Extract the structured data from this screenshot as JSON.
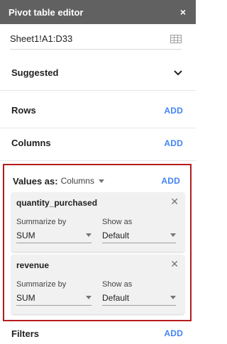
{
  "header": {
    "title": "Pivot table editor",
    "close_icon": "×"
  },
  "range": {
    "value": "Sheet1!A1:D33",
    "icon": "grid-icon"
  },
  "sections": {
    "suggested": {
      "label": "Suggested",
      "icon": "chevron-down-icon"
    },
    "rows": {
      "label": "Rows",
      "add": "ADD"
    },
    "columns": {
      "label": "Columns",
      "add": "ADD"
    },
    "filters": {
      "label": "Filters",
      "add": "ADD"
    }
  },
  "values": {
    "label": "Values as:",
    "mode": "Columns",
    "add": "ADD",
    "highlight_color": "#b71c1c",
    "items": [
      {
        "name": "quantity_purchased",
        "summarize_label": "Summarize by",
        "summarize_value": "SUM",
        "show_label": "Show as",
        "show_value": "Default"
      },
      {
        "name": "revenue",
        "summarize_label": "Summarize by",
        "summarize_value": "SUM",
        "show_label": "Show as",
        "show_value": "Default"
      }
    ]
  },
  "accent_color": "#4285f4"
}
